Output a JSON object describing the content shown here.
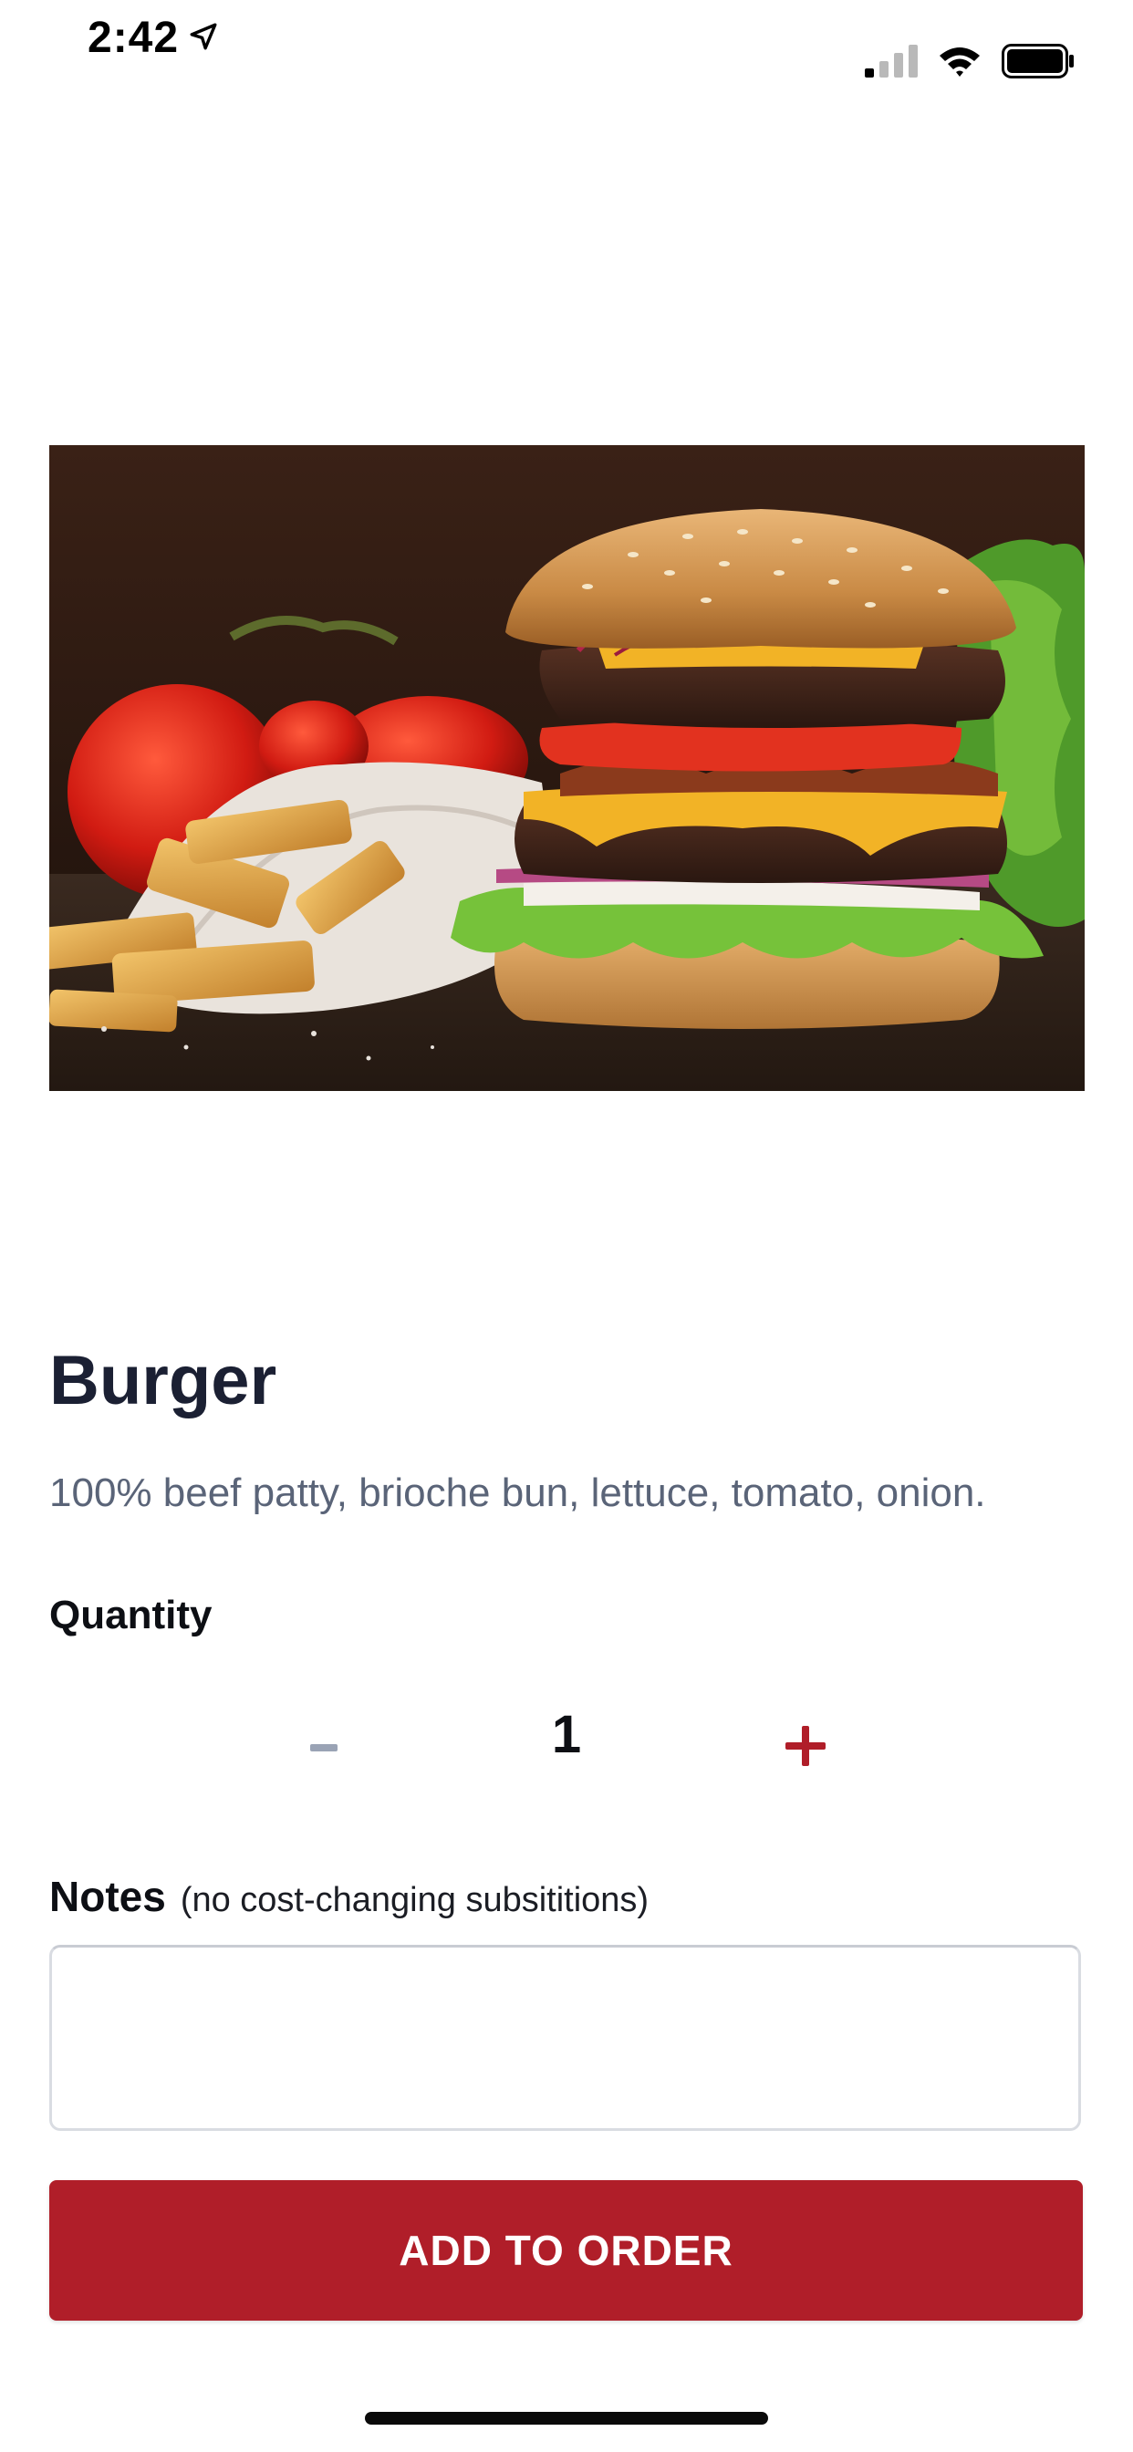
{
  "status_bar": {
    "time": "2:42",
    "icons": [
      "location-arrow-icon",
      "cellular-signal-icon",
      "wifi-icon",
      "battery-icon"
    ]
  },
  "item": {
    "image_alt": "burger-photo",
    "title": "Burger",
    "description": "100% beef patty, brioche bun, lettuce, tomato, onion."
  },
  "quantity": {
    "label": "Quantity",
    "decrement_label": "-",
    "increment_label": "+",
    "value": "1"
  },
  "notes": {
    "label": "Notes",
    "hint": "(no cost-changing subsititions)",
    "value": "",
    "placeholder": ""
  },
  "actions": {
    "add_to_order_label": "ADD TO ORDER"
  },
  "colors": {
    "accent": "#b01e29",
    "title": "#1b2033",
    "description": "#5a6478",
    "disabled": "#9aa3b5"
  }
}
